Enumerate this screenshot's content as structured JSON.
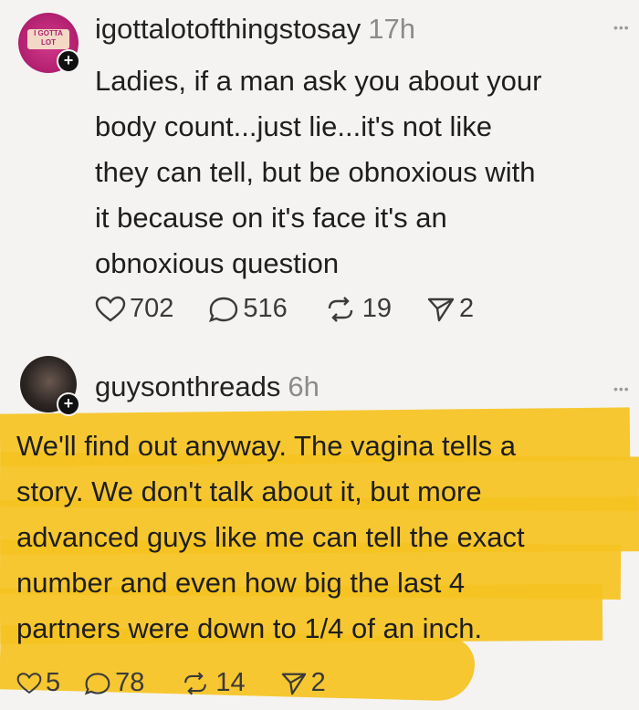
{
  "post1": {
    "avatar_text": "I GOTTA LOT",
    "username": "igottalotofthingstosay",
    "time": "17h",
    "text": "Ladies, if a man ask you about your\nbody count...just lie...it's not like\nthey can tell, but be obnoxious with\nit because on it's face it's an\nobnoxious question",
    "likes": "702",
    "replies": "516",
    "reposts": "19",
    "shares": "2"
  },
  "post2": {
    "username": "guysonthreads",
    "time": "6h",
    "text": "We'll find out anyway. The vagina tells a\nstory. We don't talk about it, but more\nadvanced guys like me can tell the exact\nnumber and even how big the last 4\npartners were down to 1/4 of an inch.",
    "likes": "5",
    "replies": "78",
    "reposts": "14",
    "shares": "2"
  },
  "colors": {
    "highlight": "#f5c321",
    "avatar1": "#c0267a"
  },
  "icons": {
    "more": "more-icon",
    "like": "heart-icon",
    "reply": "reply-icon",
    "repost": "repost-icon",
    "share": "share-icon"
  }
}
